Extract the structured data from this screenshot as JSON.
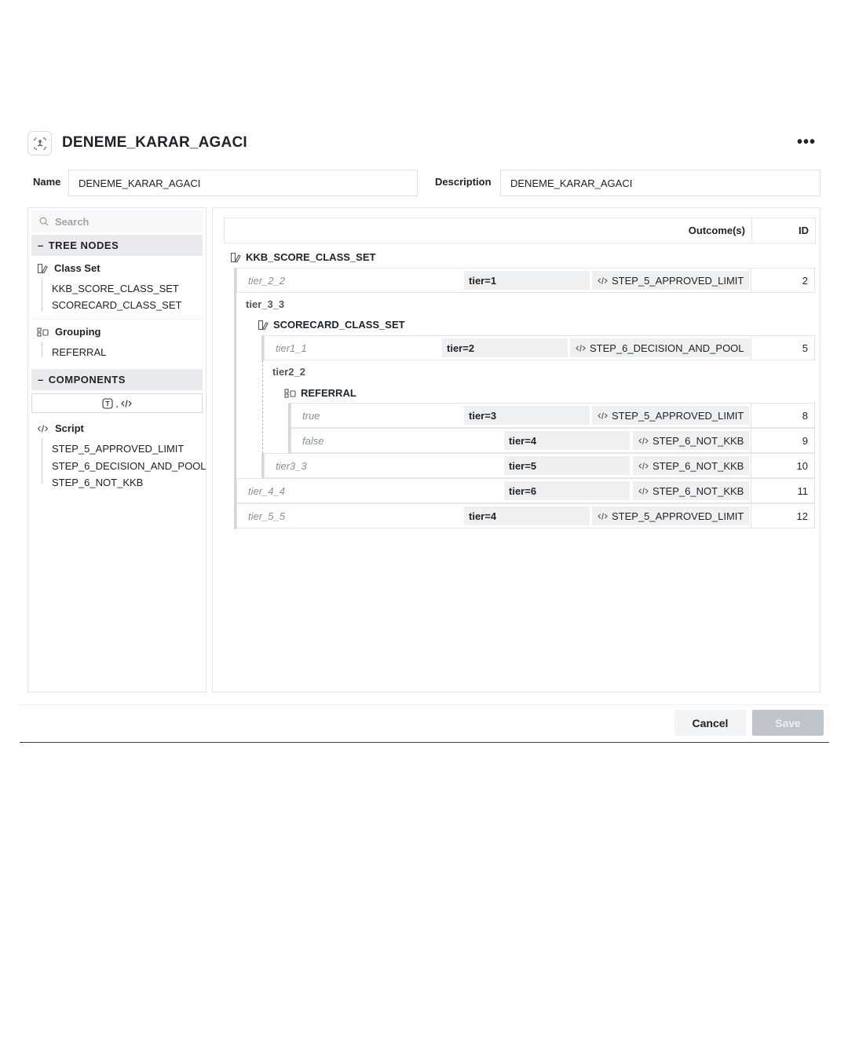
{
  "header": {
    "title": "DENEME_KARAR_AGACI",
    "more_label": "•••"
  },
  "form": {
    "name_label": "Name",
    "name_value": "DENEME_KARAR_AGACI",
    "description_label": "Description",
    "description_value": "DENEME_KARAR_AGACI"
  },
  "sidebar": {
    "search_placeholder": "Search",
    "tree_nodes_label": "TREE NODES",
    "class_set": {
      "label": "Class Set",
      "items": [
        "KKB_SCORE_CLASS_SET",
        "SCORECARD_CLASS_SET"
      ]
    },
    "grouping": {
      "label": "Grouping",
      "items": [
        "REFERRAL"
      ]
    },
    "components_label": "COMPONENTS",
    "component_sep": ",",
    "script": {
      "label": "Script",
      "items": [
        "STEP_5_APPROVED_LIMIT",
        "STEP_6_DECISION_AND_POOL",
        "STEP_6_NOT_KKB"
      ]
    }
  },
  "table": {
    "outcome_header": "Outcome(s)",
    "id_header": "ID",
    "root_node": "KKB_SCORE_CLASS_SET",
    "sub_node": "SCORECARD_CLASS_SET",
    "group_node": "REFERRAL",
    "branches": {
      "tier_3_3": "tier_3_3",
      "tier2_2": "tier2_2"
    },
    "rows": [
      {
        "label": "tier_2_2",
        "condition": "tier=1",
        "outcome": "STEP_5_APPROVED_LIMIT",
        "id": "2"
      },
      {
        "label": "tier1_1",
        "condition": "tier=2",
        "outcome": "STEP_6_DECISION_AND_POOL",
        "id": "5"
      },
      {
        "label": "true",
        "condition": "tier=3",
        "outcome": "STEP_5_APPROVED_LIMIT",
        "id": "8"
      },
      {
        "label": "false",
        "condition": "tier=4",
        "outcome": "STEP_6_NOT_KKB",
        "id": "9"
      },
      {
        "label": "tier3_3",
        "condition": "tier=5",
        "outcome": "STEP_6_NOT_KKB",
        "id": "10"
      },
      {
        "label": "tier_4_4",
        "condition": "tier=6",
        "outcome": "STEP_6_NOT_KKB",
        "id": "11"
      },
      {
        "label": "tier_5_5",
        "condition": "tier=4",
        "outcome": "STEP_5_APPROVED_LIMIT",
        "id": "12"
      }
    ]
  },
  "footer": {
    "cancel_label": "Cancel",
    "save_label": "Save"
  }
}
